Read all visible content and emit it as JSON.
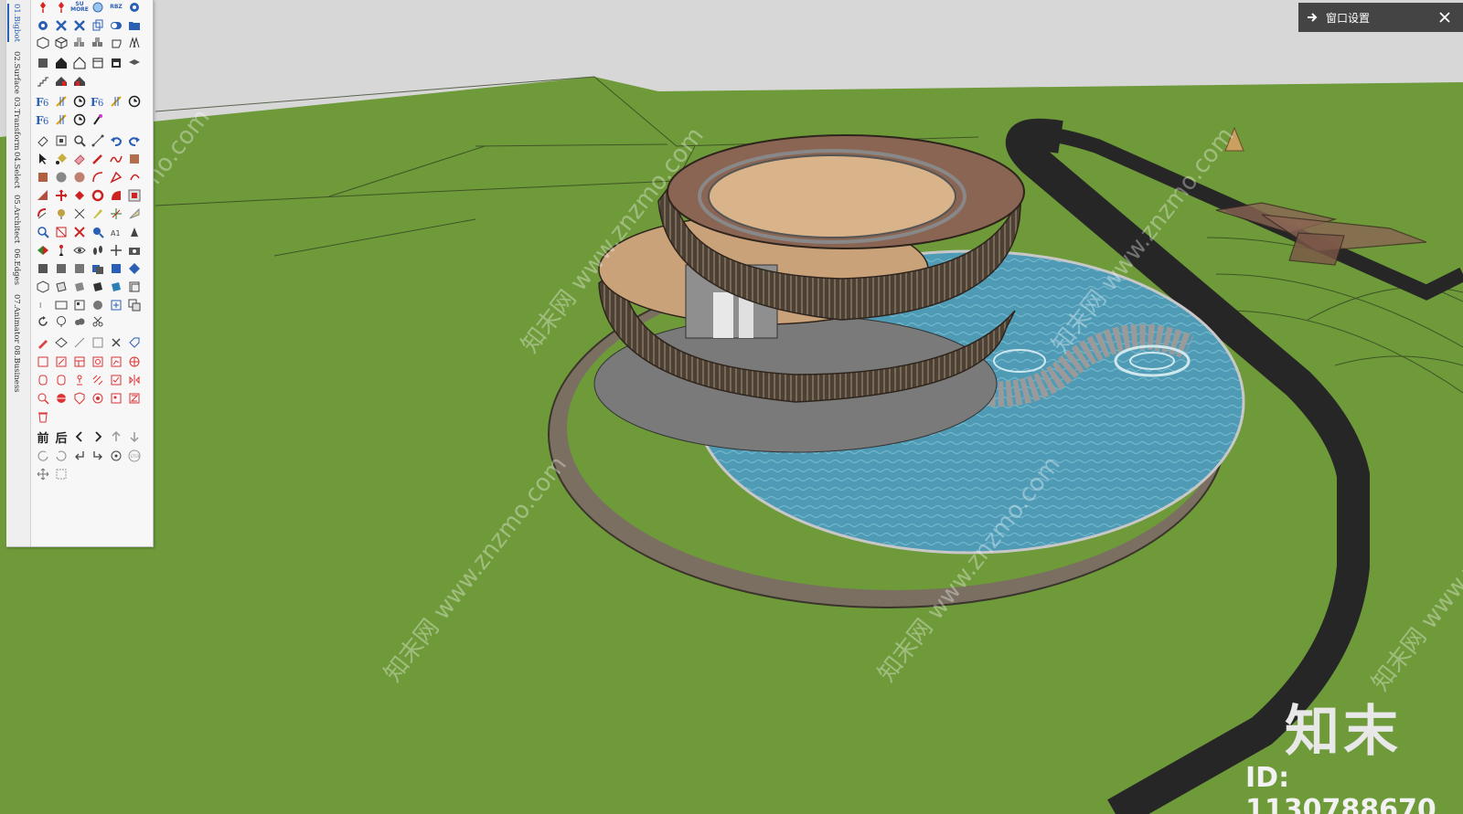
{
  "toolbar": {
    "tabs": [
      "01.Bigbot",
      "02.Surface",
      "03.Transform",
      "04.Select",
      "05.Architect",
      "06.Edges",
      "07.Animator",
      "08.Business"
    ],
    "row_labels": {
      "more": "SU\nMORE",
      "rbz": "RBZ",
      "front": "前",
      "back": "后"
    }
  },
  "window_settings": {
    "label": "窗口设置"
  },
  "watermarks": [
    "知末网 www.znzmo.com",
    "知末网 www.znzmo.com",
    "知末网 www.znzmo.com",
    "知末网 www.znzmo.com",
    "知末网 www.znzmo.com",
    "知末网 www.znzmo.com"
  ],
  "brand": {
    "name": "知末",
    "id": "ID: 1130788670"
  },
  "colors": {
    "ground": "#6f9a3b",
    "sky": "#d6d6d6",
    "road": "#2a2a2a",
    "water": "#5aa0b8",
    "building": "#5b4a3c",
    "roof": "#c8a07a"
  }
}
